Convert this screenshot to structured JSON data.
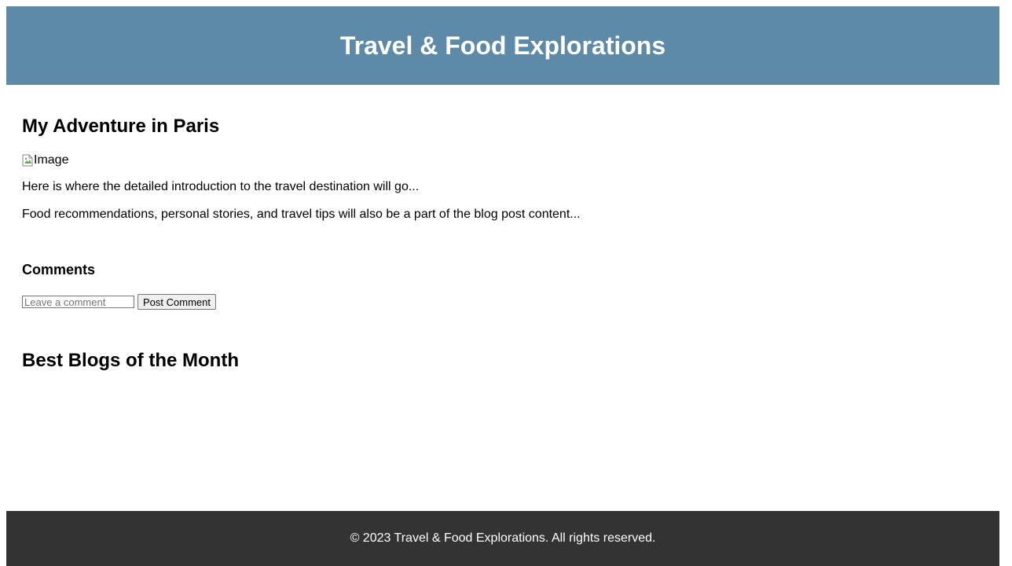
{
  "header": {
    "title": "Travel & Food Explorations"
  },
  "post": {
    "title": "My Adventure in Paris",
    "image_alt": "Image",
    "intro": "Here is where the detailed introduction to the travel destination will go...",
    "content": "Food recommendations, personal stories, and travel tips will also be a part of the blog post content..."
  },
  "comments": {
    "title": "Comments",
    "input_placeholder": "Leave a comment",
    "input_value": "",
    "post_label": "Post Comment"
  },
  "best_blogs": {
    "title": "Best Blogs of the Month"
  },
  "footer": {
    "text": "© 2023 Travel & Food Explorations. All rights reserved."
  },
  "colors": {
    "header_bg": "#5d8aa8",
    "footer_bg": "#333333",
    "header_text": "#ffffff"
  }
}
